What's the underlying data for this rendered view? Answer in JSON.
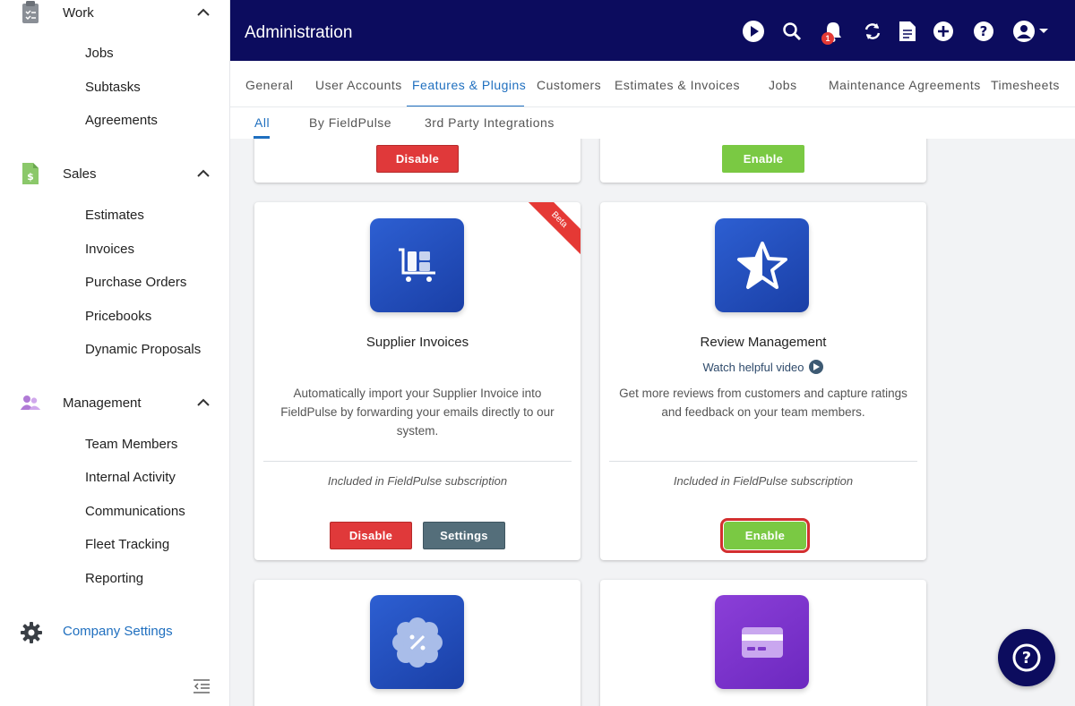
{
  "sidebar": {
    "work": {
      "label": "Work",
      "items": [
        "Jobs",
        "Subtasks",
        "Agreements"
      ]
    },
    "sales": {
      "label": "Sales",
      "items": [
        "Estimates",
        "Invoices",
        "Purchase Orders",
        "Pricebooks",
        "Dynamic Proposals"
      ]
    },
    "management": {
      "label": "Management",
      "items": [
        "Team Members",
        "Internal Activity",
        "Communications",
        "Fleet Tracking",
        "Reporting"
      ]
    },
    "company_settings": "Company Settings"
  },
  "header": {
    "title": "Administration",
    "notification_count": "1",
    "icons": [
      "play-icon",
      "search-icon",
      "bell-icon",
      "sync-icon",
      "document-icon",
      "add-icon",
      "help-icon",
      "user-icon"
    ]
  },
  "tabs": [
    "General",
    "User Accounts",
    "Features & Plugins",
    "Customers",
    "Estimates & Invoices",
    "Jobs",
    "Maintenance Agreements",
    "Timesheets"
  ],
  "active_tab": "Features & Plugins",
  "subtabs": [
    "All",
    "By FieldPulse",
    "3rd Party Integrations"
  ],
  "active_subtab": "All",
  "cards": {
    "top_left": {
      "button": "Disable"
    },
    "top_right": {
      "button": "Enable"
    },
    "supplier": {
      "title": "Supplier Invoices",
      "ribbon": "Beta",
      "description": "Automatically import your Supplier Invoice into FieldPulse by forwarding your emails directly to our system.",
      "included": "Included in FieldPulse subscription",
      "disable": "Disable",
      "settings": "Settings"
    },
    "review": {
      "title": "Review Management",
      "video": "Watch helpful video",
      "description": "Get more reviews from customers and capture ratings and feedback on your team members.",
      "included": "Included in FieldPulse subscription",
      "enable": "Enable"
    }
  },
  "colors": {
    "navy": "#0c0c5e",
    "accent": "#1f6fbf",
    "red": "#e0393a",
    "green": "#7ac943",
    "slate": "#546e7a"
  }
}
